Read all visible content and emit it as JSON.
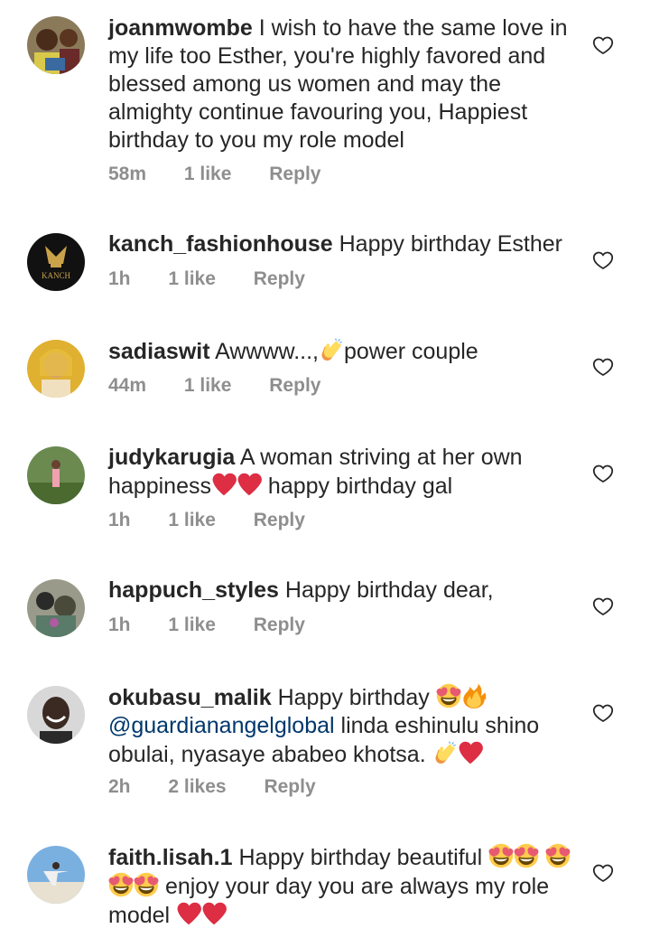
{
  "comments": [
    {
      "username": "joanmwombe",
      "text": "I wish to have the same love in my life too Esther, you're highly favored and blessed among us women and may the almighty continue favouring you, Happiest birthday to you my role model",
      "time": "58m",
      "likes": "1 like",
      "reply": "Reply"
    },
    {
      "username": "kanch_fashionhouse",
      "text": "Happy birthday Esther",
      "time": "1h",
      "likes": "1 like",
      "reply": "Reply",
      "avatar_label": "KANCH"
    },
    {
      "username": "sadiaswit",
      "text_before": "Awwww...,",
      "text_after": "power couple",
      "time": "44m",
      "likes": "1 like",
      "reply": "Reply"
    },
    {
      "username": "judykarugia",
      "text_before": "A woman striving at her own happiness",
      "text_after": " happy birthday gal",
      "time": "1h",
      "likes": "1 like",
      "reply": "Reply"
    },
    {
      "username": "happuch_styles",
      "text": "Happy birthday dear,",
      "time": "1h",
      "likes": "1 like",
      "reply": "Reply"
    },
    {
      "username": "okubasu_malik",
      "text_before": "Happy birthday",
      "mention": "@guardianangelglobal",
      "text_after": " linda eshinulu shino obulai, nyasaye ababeo khotsa.",
      "time": "2h",
      "likes": "2 likes",
      "reply": "Reply"
    },
    {
      "username": "faith.lisah.1",
      "text_before": "Happy birthday beautiful",
      "text_middle": " enjoy your day you are always my role model",
      "time": "",
      "likes": "",
      "reply": ""
    }
  ],
  "icons": {
    "like": "heart-outline-icon"
  },
  "colors": {
    "primary_text": "#262626",
    "meta_text": "#8e8e8e",
    "mention": "#00376b",
    "heart_emoji": "#dd2e44"
  }
}
